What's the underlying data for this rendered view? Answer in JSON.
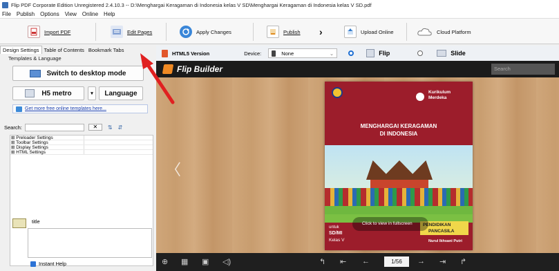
{
  "window": {
    "title": "Flip PDF Corporate Edition Unregistered 2.4.10.3 -- D:\\Menghargai Keragaman di Indonesia kelas V SD\\Menghargai Keragaman di Indonesia kelas V SD.pdf"
  },
  "menu": [
    "File",
    "Publish",
    "Options",
    "View",
    "Online",
    "Help"
  ],
  "toolbar": {
    "import_pdf": "Import PDF",
    "edit_pages": "Edit Pages",
    "apply_changes": "Apply Changes",
    "publish": "Publish",
    "upload_online": "Upload Online",
    "cloud_platform": "Cloud Platform"
  },
  "tabs": [
    "Design Settings",
    "Table of Contents",
    "Bookmark Tabs"
  ],
  "left": {
    "templates_label": "Templates & Language",
    "switch_desktop": "Switch to desktop mode",
    "template_name": "H5 metro",
    "language": "Language",
    "get_templates": "Get more free online templates here...",
    "search_label": "Search:",
    "tree": [
      "⊞ Preloader Settings",
      "⊞ Toolbar Settings",
      "⊞ Display Settings",
      "⊞ HTML Settings"
    ],
    "help_title": "title",
    "instant_help": "Instant Help"
  },
  "preview": {
    "html5_version": "HTML5 Version",
    "device_label": "Device:",
    "device_value": "None",
    "flip": "Flip",
    "slide": "Slide",
    "mode_selected": "Flip"
  },
  "flipbuilder": {
    "logo": "Flip Builder",
    "search_placeholder": "Search"
  },
  "book": {
    "kurikulum_line1": "Kurikulum",
    "kurikulum_line2": "Merdeka",
    "title_line1": "MENGHARGAI KERAGAMAN",
    "title_line2": "DI INDONESIA",
    "click_to_view": "Click to view in fullscreen",
    "subject_line1": "PENDIDIKAN",
    "subject_line2": "PANCASILA",
    "untuk": "untuk",
    "level1": "SD/MI",
    "level2": "Kelas V",
    "author": "Nurul Ikhsani Putri"
  },
  "pager": {
    "page_display": "1/56"
  },
  "colors": {
    "cover_red": "#9c1d2b",
    "header_dark": "#1b1b1b",
    "annotation_arrow": "#e02020"
  }
}
